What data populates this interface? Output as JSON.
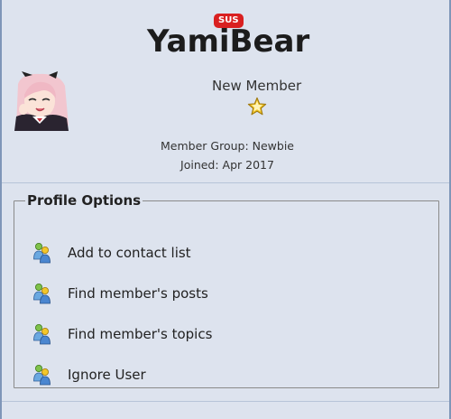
{
  "profile": {
    "username": "YamiBear",
    "badge": "SUS",
    "rank_title": "New Member",
    "member_group": "Member Group: Newbie",
    "joined": "Joined: Apr 2017"
  },
  "profile_options": {
    "legend": "Profile Options",
    "items": [
      {
        "label": "Add to contact list",
        "icon": "users-icon"
      },
      {
        "label": "Find member's posts",
        "icon": "users-icon"
      },
      {
        "label": "Find member's topics",
        "icon": "users-icon"
      },
      {
        "label": "Ignore User",
        "icon": "users-icon"
      }
    ]
  },
  "colors": {
    "background": "#dde3ee",
    "frame": "#7f96b8",
    "badge": "#d92020",
    "star": "#f3c623"
  }
}
